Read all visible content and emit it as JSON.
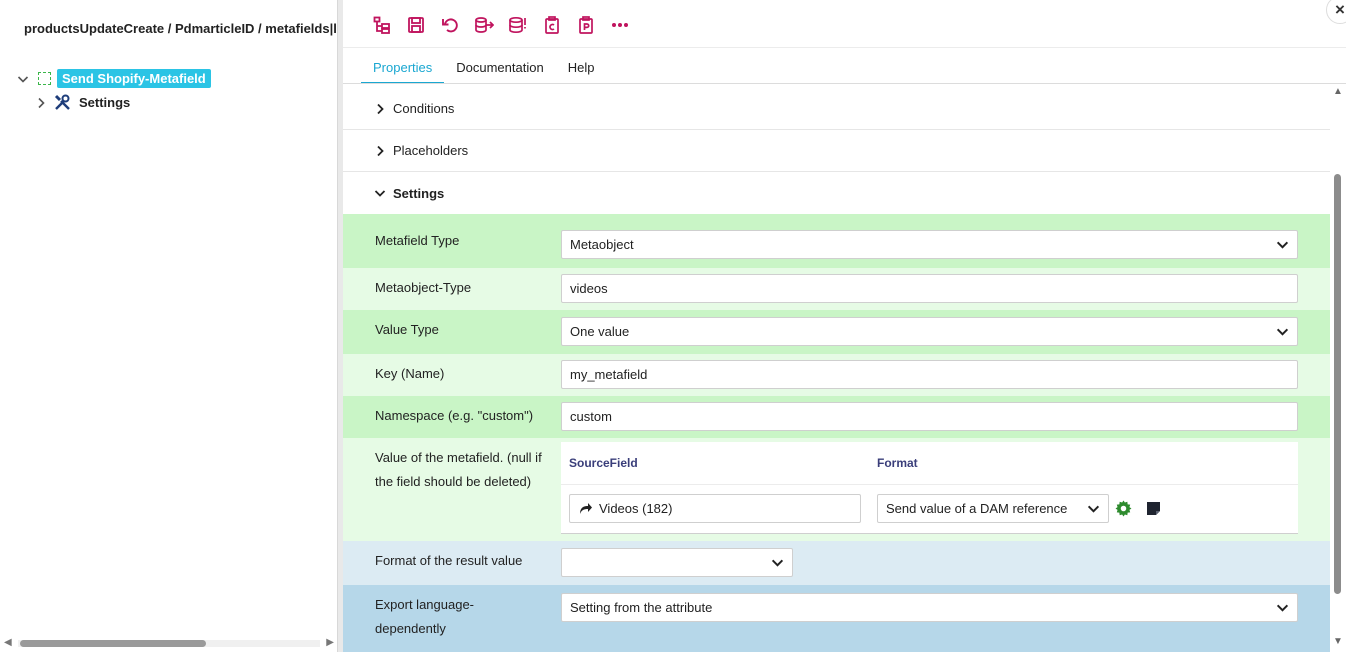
{
  "left_panel": {
    "title": "productsUpdateCreate / PdmarticleID / metafields|la",
    "tree": {
      "root_label": "Send Shopify-Metafield",
      "child_label": "Settings"
    }
  },
  "toolbar": {
    "icons": [
      "tree-structure-icon",
      "save-icon",
      "undo-icon",
      "export-icon",
      "database-icon",
      "clipboard-c-icon",
      "clipboard-p-icon",
      "more-icon"
    ],
    "close": "×",
    "accent": "#c0145e"
  },
  "tabs": [
    "Properties",
    "Documentation",
    "Help"
  ],
  "sections": {
    "conditions": "Conditions",
    "placeholders": "Placeholders",
    "settings": "Settings"
  },
  "form": {
    "metafield_type": {
      "label": "Metafield Type",
      "value": "Metaobject"
    },
    "metaobject_type": {
      "label": "Metaobject-Type",
      "value": "videos"
    },
    "value_type": {
      "label": "Value Type",
      "value": "One value"
    },
    "key_name": {
      "label": "Key (Name)",
      "value": "my_metafield"
    },
    "namespace": {
      "label": "Namespace (e.g. \"custom\")",
      "value": "custom"
    },
    "metafield_value": {
      "label": "Value of the metafield. (null if the field should be deleted)",
      "col_source": "SourceField",
      "col_format": "Format",
      "source_value": "Videos (182)",
      "format_value": "Send value of a DAM reference"
    },
    "result_format": {
      "label": "Format of the result value",
      "value": ""
    },
    "export_language": {
      "label": "Export language-dependently",
      "value": "Setting from the attribute"
    }
  },
  "colors": {
    "row_green": "#c9f5c6",
    "row_light_green": "#e6fbe5",
    "row_light_blue": "#dcebf3",
    "row_blue": "#b6d7e9",
    "tab_active": "#1aa7d1",
    "tree_highlight": "#2bc4e5"
  }
}
